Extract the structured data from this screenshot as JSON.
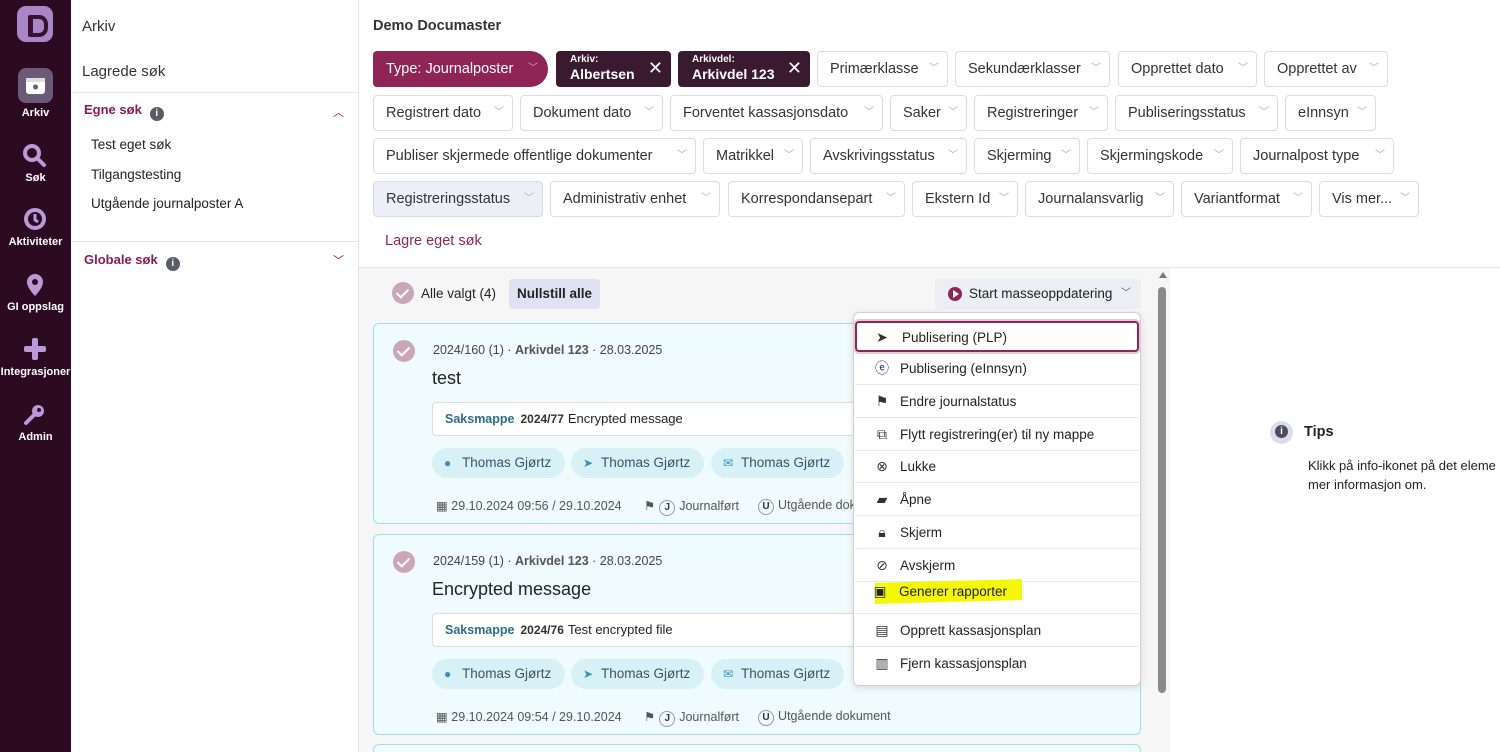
{
  "rail": {
    "items": [
      {
        "label": "Arkiv",
        "icon": "archive-icon",
        "active": true
      },
      {
        "label": "Søk",
        "icon": "search-icon"
      },
      {
        "label": "Aktiviteter",
        "icon": "activity-icon"
      },
      {
        "label": "GI oppslag",
        "icon": "location-pin-icon"
      },
      {
        "label": "Integrasjoner",
        "icon": "plus-icon"
      },
      {
        "label": "Admin",
        "icon": "key-icon"
      }
    ]
  },
  "sidebar": {
    "title": "Arkiv",
    "saved": "Lagrede søk",
    "own_section": "Egne søk",
    "own_items": [
      "Test eget søk",
      "Tilgangstesting",
      "Utgående journalposter A"
    ],
    "global_section": "Globale søk"
  },
  "header": {
    "title": "Demo Documaster",
    "type_chip": "Type: Journalposter",
    "archive_chip": {
      "small": "Arkiv:",
      "value": "Albertsen"
    },
    "part_chip": {
      "small": "Arkivdel:",
      "value": "Arkivdel 123"
    },
    "filters": [
      "Primærklasse",
      "Sekundærklasser",
      "Opprettet dato",
      "Opprettet av",
      "Registrert dato",
      "Dokument dato",
      "Forventet kassasjonsdato",
      "Saker",
      "Registreringer",
      "Publiseringsstatus",
      "eInnsyn",
      "Publiser skjermede offentlige dokumenter",
      "Matrikkel",
      "Avskrivingsstatus",
      "Skjerming",
      "Skjermingskode",
      "Journalpost type",
      "Registreringsstatus",
      "Administrativ enhet",
      "Korrespondansepart",
      "Ekstern Id",
      "Journalansvarlig",
      "Variantformat",
      "Vis mer..."
    ],
    "save_search": "Lagre eget søk"
  },
  "toolbar": {
    "all_selected": "Alle valgt (4)",
    "reset": "Nullstill alle",
    "mass_update": "Start masseoppdatering"
  },
  "cards": [
    {
      "id": "2024/160 (1)",
      "part": "Arkivdel 123",
      "date": "28.03.2025",
      "title": "test",
      "case_label": "Saksmappe",
      "case_no": "2024/77",
      "case_title": "Encrypted message",
      "parties": [
        "Thomas Gjørtz",
        "Thomas Gjørtz",
        "Thomas Gjørtz"
      ],
      "created": "29.10.2024 09:56",
      "registered": "29.10.2024",
      "status_letter": "J",
      "status": "Journalført",
      "type_letter": "U",
      "type": "Utgående dok"
    },
    {
      "id": "2024/159 (1)",
      "part": "Arkivdel 123",
      "date": "28.03.2025",
      "title": "Encrypted message",
      "case_label": "Saksmappe",
      "case_no": "2024/76",
      "case_title": "Test encrypted file",
      "parties": [
        "Thomas Gjørtz",
        "Thomas Gjørtz",
        "Thomas Gjørtz"
      ],
      "created": "29.10.2024 09:54",
      "registered": "29.10.2024",
      "status_letter": "J",
      "status": "Journalført",
      "type_letter": "U",
      "type": "Utgående dokument"
    }
  ],
  "menu": {
    "items": [
      {
        "label": "Publisering (PLP)",
        "icon": "send-icon"
      },
      {
        "label": "Publisering (eInnsyn)",
        "icon": "einnsyn-icon"
      },
      {
        "label": "Endre journalstatus",
        "icon": "flag-icon"
      },
      {
        "label": "Flytt registrering(er) til ny mappe",
        "icon": "move-icon"
      },
      {
        "label": "Lukke",
        "icon": "close-circle-icon"
      },
      {
        "label": "Åpne",
        "icon": "folder-open-icon"
      },
      {
        "label": "Skjerm",
        "icon": "lock-icon"
      },
      {
        "label": "Avskjerm",
        "icon": "unlock-icon"
      },
      {
        "label": "Generer rapporter",
        "icon": "report-icon"
      },
      {
        "label": "Opprett kassasjonsplan",
        "icon": "plan-add-icon"
      },
      {
        "label": "Fjern kassasjonsplan",
        "icon": "plan-remove-icon"
      }
    ]
  },
  "tips": {
    "title": "Tips",
    "body": "Klikk på info-ikonet på det eleme\nmer informasjon om."
  },
  "colors": {
    "accent": "#8f2457",
    "rail": "#2c0a22",
    "card_border": "#9fdde8",
    "highlight": "#f4f70a"
  }
}
